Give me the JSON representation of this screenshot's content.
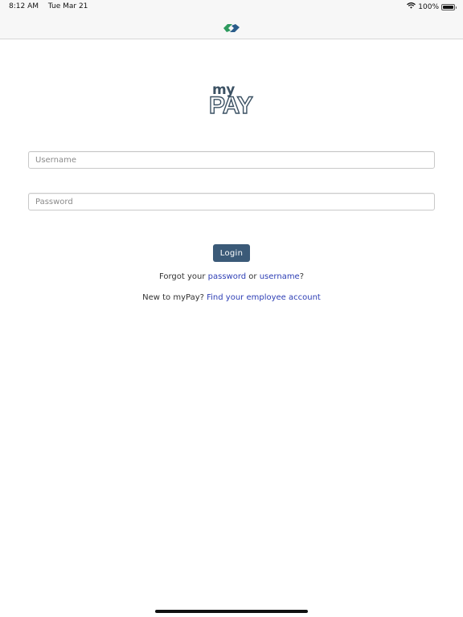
{
  "status_bar": {
    "time": "8:12 AM",
    "date": "Tue Mar 21",
    "battery_percent": "100%",
    "battery_level": 1.0,
    "icons": [
      "wifi-icon",
      "battery-icon"
    ]
  },
  "nav_bar": {
    "logo_icon": "company-logo-icon",
    "logo_colors": [
      "#2e9a5e",
      "#2a5c8a"
    ]
  },
  "logo": {
    "my": "my",
    "pay": "PAY",
    "color": "#3b5163"
  },
  "form": {
    "username": {
      "value": "",
      "placeholder": "Username"
    },
    "password": {
      "value": "",
      "placeholder": "Password"
    },
    "login_label": "Login",
    "login_color": "#3b5a78"
  },
  "links": {
    "forgot_prefix": "Forgot your ",
    "password_link": "password",
    "forgot_or": " or ",
    "username_link": "username",
    "forgot_suffix": "?",
    "new_prefix": "New to myPay? ",
    "find_account_link": "Find your employee account",
    "link_color": "#2e3fb5"
  }
}
